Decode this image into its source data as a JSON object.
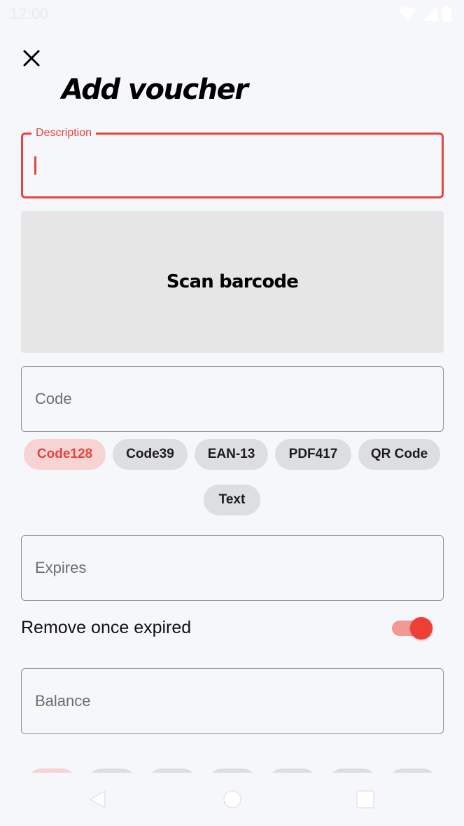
{
  "status_bar": {
    "time": "12:00"
  },
  "header": {
    "title": "Add voucher"
  },
  "description_field": {
    "label": "Description",
    "value": ""
  },
  "scan": {
    "label": "Scan barcode"
  },
  "code_field": {
    "placeholder": "Code"
  },
  "barcode_types": {
    "chips": [
      {
        "label": "Code128",
        "selected": true
      },
      {
        "label": "Code39",
        "selected": false
      },
      {
        "label": "EAN-13",
        "selected": false
      },
      {
        "label": "PDF417",
        "selected": false
      },
      {
        "label": "QR Code",
        "selected": false
      },
      {
        "label": "Text",
        "selected": false
      }
    ]
  },
  "expires_field": {
    "placeholder": "Expires"
  },
  "remove_expired": {
    "label": "Remove once expired",
    "enabled": true
  },
  "balance_field": {
    "placeholder": "Balance"
  },
  "colors": {
    "accent": "#e5443c",
    "chip_selected_bg": "#f7d3d3",
    "chip_bg": "#dddee2",
    "background": "#f6f7fb"
  },
  "icons": [
    "close-icon",
    "wifi-icon",
    "signal-icon",
    "battery-icon",
    "back-icon",
    "home-icon",
    "recents-icon"
  ]
}
